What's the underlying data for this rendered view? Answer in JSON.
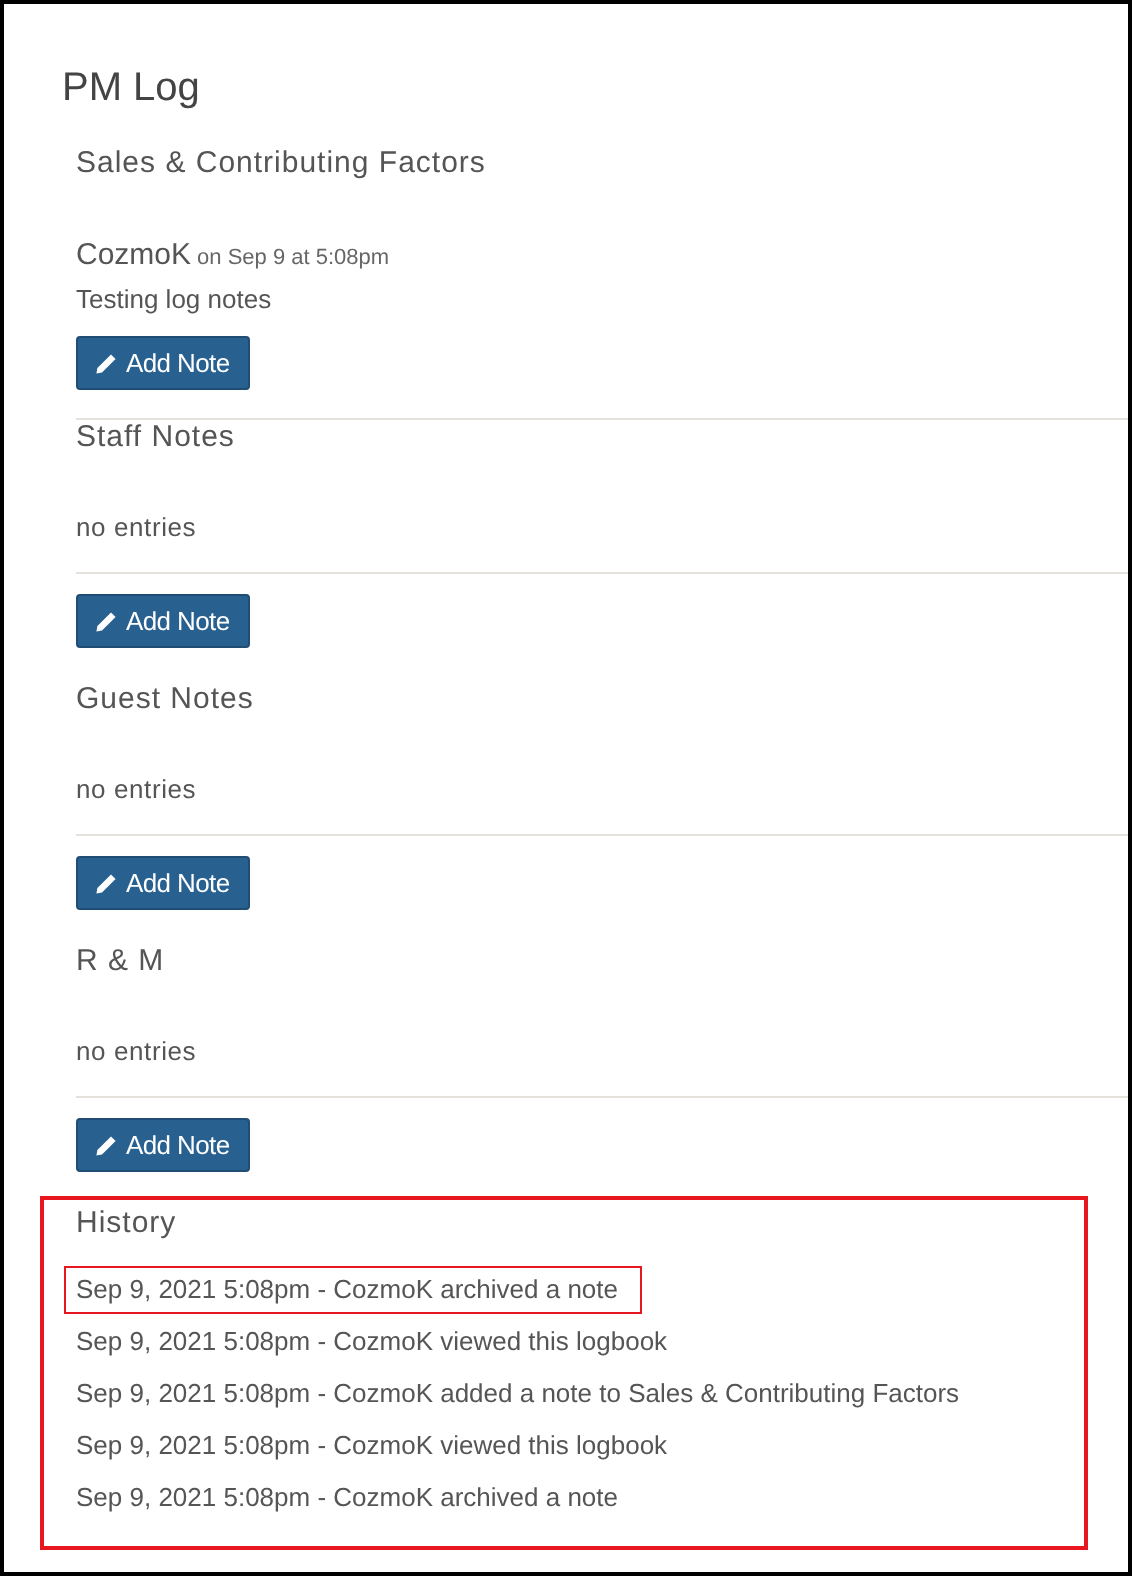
{
  "title": "PM Log",
  "sections": [
    {
      "heading": "Sales & Contributing Factors",
      "entries": [
        {
          "author": "CozmoK",
          "timestamp": "on Sep 9 at 5:08pm",
          "note": "Testing log notes"
        }
      ],
      "button": "Add Note"
    },
    {
      "heading": "Staff Notes",
      "empty_text": "no entries",
      "button": "Add Note"
    },
    {
      "heading": "Guest Notes",
      "empty_text": "no entries",
      "button": "Add Note"
    },
    {
      "heading": "R & M",
      "empty_text": "no entries",
      "button": "Add Note"
    }
  ],
  "history": {
    "heading": "History",
    "highlighted": true,
    "entries": [
      {
        "text": "Sep 9, 2021 5:08pm - CozmoK archived a note",
        "highlighted": true
      },
      {
        "text": "Sep 9, 2021 5:08pm - CozmoK viewed this logbook",
        "highlighted": false
      },
      {
        "text": "Sep 9, 2021 5:08pm - CozmoK added a note to Sales & Contributing Factors",
        "highlighted": false
      },
      {
        "text": "Sep 9, 2021 5:08pm - CozmoK viewed this logbook",
        "highlighted": false
      },
      {
        "text": "Sep 9, 2021 5:08pm - CozmoK archived a note",
        "highlighted": false
      }
    ]
  }
}
